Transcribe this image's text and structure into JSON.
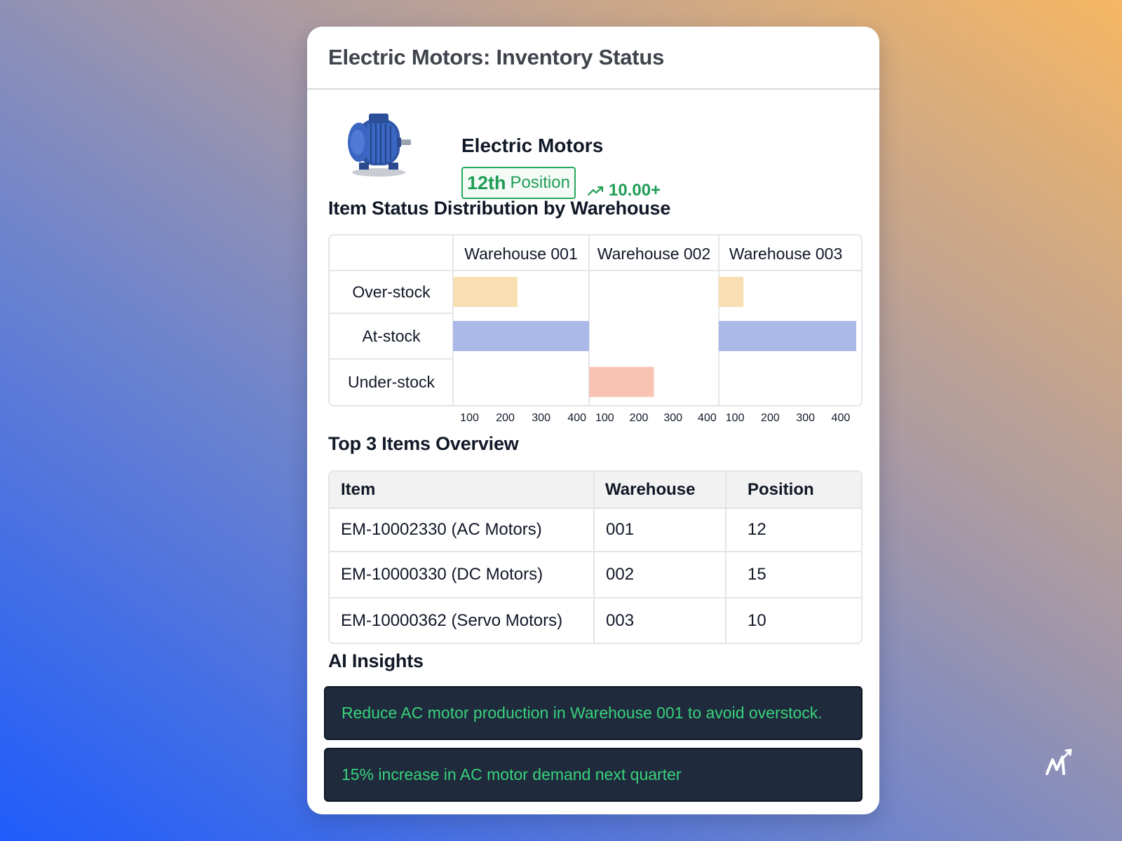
{
  "card": {
    "title": "Electric Motors: Inventory Status"
  },
  "product": {
    "name": "Electric Motors",
    "rank": "12th",
    "rank_label": "Position",
    "trend_icon": "trending-up-icon",
    "trend_value": "10.00+"
  },
  "distribution": {
    "title": "Item Status Distribution by Warehouse"
  },
  "chart_data": {
    "type": "bar",
    "title": "Item Status Distribution by Warehouse",
    "orientation": "horizontal",
    "panels": [
      "Warehouse 001",
      "Warehouse 002",
      "Warehouse 003"
    ],
    "categories": [
      "Over-stock",
      "At-stock",
      "Under-stock"
    ],
    "xticks": [
      100,
      200,
      300,
      400
    ],
    "xlim": [
      50,
      430
    ],
    "grid": false,
    "legend": "none",
    "colors": {
      "Over-stock": "#f9deb3",
      "At-stock": "#aab9e8",
      "Under-stock": "#f8c3b3"
    },
    "values": [
      [
        230,
        430,
        0
      ],
      [
        0,
        0,
        240
      ],
      [
        120,
        440,
        0
      ]
    ]
  },
  "top_items": {
    "title": "Top 3 Items Overview",
    "columns": [
      "Item",
      "Warehouse",
      "Position"
    ],
    "rows": [
      [
        "EM-10002330 (AC Motors)",
        "001",
        "12"
      ],
      [
        "EM-10000330 (DC Motors)",
        "002",
        "15"
      ],
      [
        "EM-10000362 (Servo Motors)",
        "003",
        "10"
      ]
    ]
  },
  "insights": {
    "title": "AI Insights",
    "items": [
      "Reduce AC motor production in Warehouse 001 to avoid overstock.",
      "15% increase in AC motor demand next quarter"
    ]
  },
  "icons": {
    "product_image": "electric-motor-icon",
    "brand_logo": "brand-logo-icon"
  }
}
